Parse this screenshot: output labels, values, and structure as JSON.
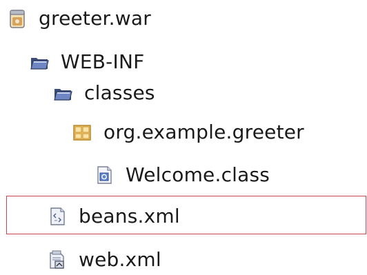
{
  "tree": {
    "nodes": [
      {
        "label": "greeter.war",
        "icon": "war-archive-icon"
      },
      {
        "label": "WEB-INF",
        "icon": "open-folder-icon"
      },
      {
        "label": "classes",
        "icon": "open-folder-icon"
      },
      {
        "label": "org.example.greeter",
        "icon": "package-icon"
      },
      {
        "label": "Welcome.class",
        "icon": "class-file-icon"
      },
      {
        "label": "beans.xml",
        "icon": "xml-file-icon"
      },
      {
        "label": "web.xml",
        "icon": "web-xml-file-icon"
      }
    ],
    "selected_label": "beans.xml"
  },
  "colors": {
    "selection_border": "#c7454d",
    "folder_fill": "#5a6fa8",
    "package_fill": "#e8b04a",
    "war_fill": "#d9b36b"
  }
}
